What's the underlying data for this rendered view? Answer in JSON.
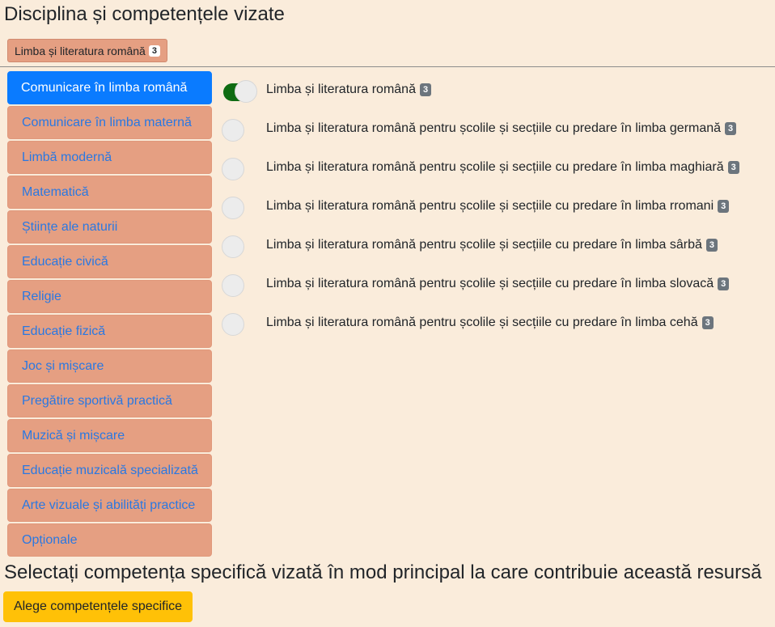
{
  "header": {
    "title": "Disciplina și competențele vizate"
  },
  "selected_chip": {
    "label": "Limba și literatura română",
    "count": "3"
  },
  "sidebar": {
    "items": [
      {
        "label": "Comunicare în limba română",
        "active": true
      },
      {
        "label": "Comunicare în limba maternă"
      },
      {
        "label": "Limbă modernă"
      },
      {
        "label": "Matematică"
      },
      {
        "label": "Științe ale naturii"
      },
      {
        "label": "Educație civică"
      },
      {
        "label": "Religie"
      },
      {
        "label": "Educație fizică"
      },
      {
        "label": "Joc și mișcare"
      },
      {
        "label": "Pregătire sportivă practică"
      },
      {
        "label": "Muzică și mișcare"
      },
      {
        "label": "Educație muzicală specializată"
      },
      {
        "label": "Arte vizuale și abilități practice"
      },
      {
        "label": "Opționale"
      }
    ]
  },
  "options": [
    {
      "label": "Limba și literatura română",
      "count": "3",
      "checked": true
    },
    {
      "label": "Limba și literatura română pentru școlile și secțiile cu predare în limba germană",
      "count": "3",
      "checked": false
    },
    {
      "label": "Limba și literatura română pentru școlile și secțiile cu predare în limba maghiară",
      "count": "3",
      "checked": false
    },
    {
      "label": "Limba și literatura română pentru școlile și secțiile cu predare în limba rromani",
      "count": "3",
      "checked": false
    },
    {
      "label": "Limba și literatura română pentru școlile și secțiile cu predare în limba sârbă",
      "count": "3",
      "checked": false
    },
    {
      "label": "Limba și literatura română pentru școlile și secțiile cu predare în limba slovacă",
      "count": "3",
      "checked": false
    },
    {
      "label": "Limba și literatura română pentru școlile și secțiile cu predare în limba cehă",
      "count": "3",
      "checked": false
    }
  ],
  "footer": {
    "question": "Selectați competența specifică vizată în mod principal la care contribuie această resursă",
    "button_label": "Alege competențele specifice"
  },
  "colors": {
    "background": "#faecdb",
    "item_bg": "#e59f82",
    "active_bg": "#0a7bff",
    "toggle_on": "#0e6b12",
    "cta": "#ffc107"
  }
}
